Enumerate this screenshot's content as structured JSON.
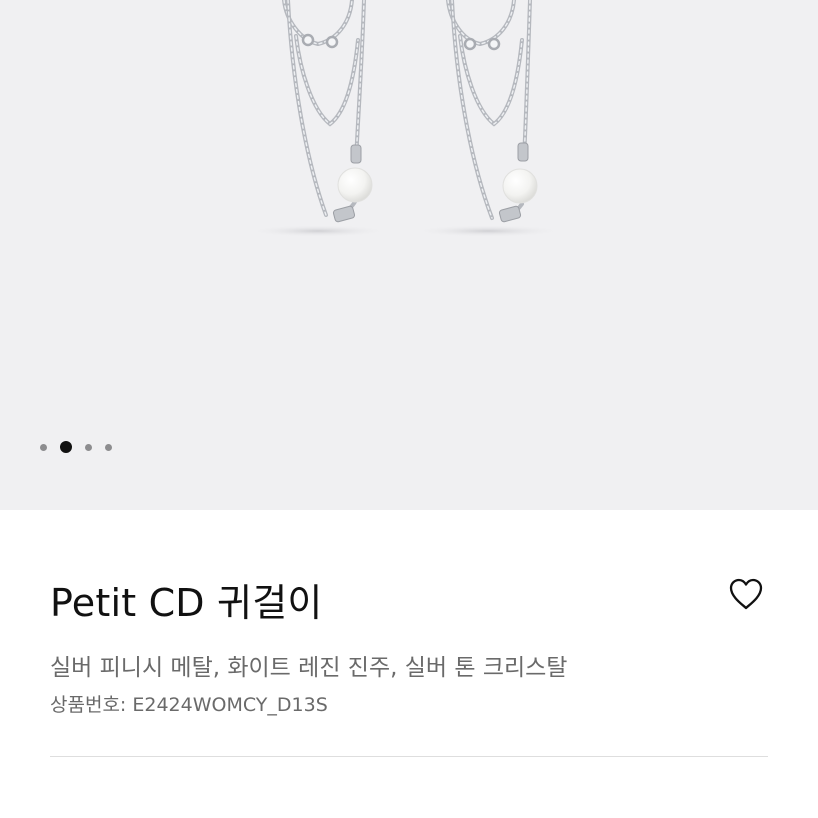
{
  "gallery": {
    "background": "#f0f0f2",
    "image_alt": "Petit CD earrings — silver chains with white resin pearls",
    "slide_count": 4,
    "active_slide": 2
  },
  "product": {
    "title": "Petit CD 귀걸이",
    "subtitle": "실버 피니시 메탈, 화이트 레진 진주, 실버 톤 크리스탈",
    "sku_label": "상품번호:",
    "sku_value": "E2424WOMCY_D13S",
    "wishlist_icon": "heart-outline-icon"
  },
  "colors": {
    "text_primary": "#111111",
    "text_secondary": "#6a6a6a",
    "divider": "#dedede",
    "dot_inactive": "#8d8d8f",
    "dot_active": "#111111"
  }
}
